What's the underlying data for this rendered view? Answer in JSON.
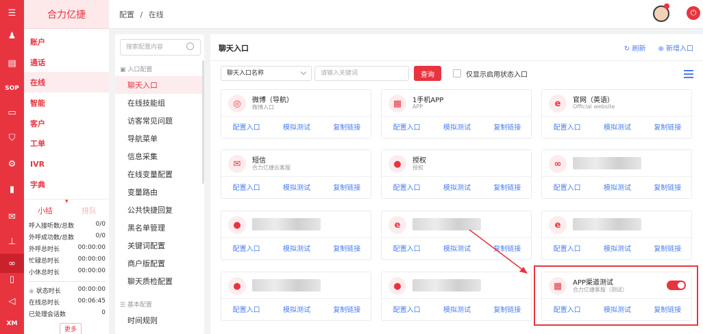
{
  "brand": {
    "name": "合力亿捷"
  },
  "rail": {
    "icons": [
      "menu-icon",
      "user-icon",
      "clipboard-icon",
      "sop-icon",
      "monitor-icon",
      "shield-icon",
      "robot-icon",
      "bar-chart-icon",
      "chat-icon",
      "org-icon",
      "handshake-icon",
      "book-icon",
      "megaphone-icon",
      "xm-icon"
    ],
    "sop_label": "SOP",
    "xm_label": "XM"
  },
  "nav": {
    "items": [
      {
        "label": "账户"
      },
      {
        "label": "通话"
      },
      {
        "label": "在线"
      },
      {
        "label": "智能"
      },
      {
        "label": "客户"
      },
      {
        "label": "工单"
      },
      {
        "label": "IVR"
      },
      {
        "label": "字典"
      }
    ]
  },
  "stats": {
    "tab_summary": "小结",
    "tab_queue": "排队",
    "rows": [
      {
        "label": "呼入接听数/总数",
        "value": "0/0"
      },
      {
        "label": "外呼成功数/总数",
        "value": "0/0"
      },
      {
        "label": "外呼总时长",
        "value": "00:00:00"
      },
      {
        "label": "忙碌总时长",
        "value": "00:00:00"
      },
      {
        "label": "小休总时长",
        "value": "00:00:00"
      },
      {
        "label": "状态时长",
        "value": "00:00:00"
      },
      {
        "label": "在线总时长",
        "value": "00:06:45"
      },
      {
        "label": "已处理会话数",
        "value": "0"
      }
    ],
    "more": "更多"
  },
  "breadcrumb": {
    "parent": "配置",
    "sep": "/",
    "current": "在线"
  },
  "config": {
    "search_placeholder": "搜索配置内容",
    "group1": "入口配置",
    "items": [
      {
        "label": "聊天入口"
      },
      {
        "label": "在线技能组"
      },
      {
        "label": "访客常见问题"
      },
      {
        "label": "导航菜单"
      },
      {
        "label": "信息采集"
      },
      {
        "label": "在线变量配置"
      },
      {
        "label": "变量路由"
      },
      {
        "label": "公共快捷回复"
      },
      {
        "label": "黑名单管理"
      },
      {
        "label": "关键词配置"
      },
      {
        "label": "商户版配置"
      },
      {
        "label": "聊天质检配置"
      }
    ],
    "group2": "基本配置",
    "items2": [
      {
        "label": "时间规则"
      }
    ]
  },
  "main": {
    "title": "聊天入口",
    "refresh": "刷新",
    "add": "新增入口",
    "filter": {
      "select_value": "聊天入口名称",
      "keyword_placeholder": "请输入关键词",
      "query": "查询",
      "checkbox_label": "仅显示启用状态入口"
    },
    "actions": {
      "config": "配置入口",
      "test": "模拟测试",
      "copy": "复制链接"
    },
    "cards": [
      {
        "name": "微博（导航）",
        "sub": "微博入口",
        "icon": "weibo-icon",
        "glyph": "◎"
      },
      {
        "name": "1手机APP",
        "sub": "APP",
        "icon": "app-grid-icon",
        "glyph": "▦"
      },
      {
        "name": "官网（英语）",
        "sub": "Official website",
        "icon": "ie-icon",
        "glyph": "e"
      },
      {
        "name": "短信",
        "sub": "合力亿捷云客服",
        "icon": "mail-icon",
        "glyph": "✉"
      },
      {
        "name": "授权",
        "sub": "授权",
        "icon": "wechat-icon",
        "glyph": "●"
      },
      {
        "name": "",
        "sub": "",
        "icon": "link-icon",
        "glyph": "∞"
      },
      {
        "name": "",
        "sub": "",
        "icon": "wechat-icon",
        "glyph": "●"
      },
      {
        "name": "",
        "sub": "",
        "icon": "ie-icon",
        "glyph": "e"
      },
      {
        "name": "",
        "sub": "",
        "icon": "ie-icon",
        "glyph": "e"
      },
      {
        "name": "",
        "sub": "",
        "icon": "wechat-icon",
        "glyph": "●"
      },
      {
        "name": "",
        "sub": "",
        "icon": "wechat-icon",
        "glyph": "●"
      },
      {
        "name": "APP渠道测试",
        "sub": "合力亿捷客服（测试）",
        "icon": "app-grid-icon",
        "glyph": "▦",
        "toggle_on": true
      }
    ]
  }
}
